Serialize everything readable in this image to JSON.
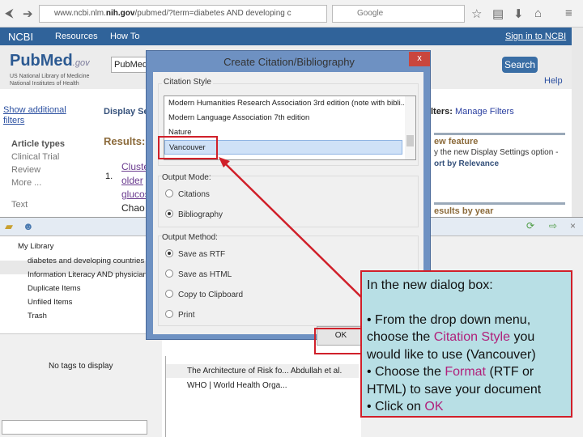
{
  "browser": {
    "url_prefix": "www.ncbi.nlm.",
    "url_domain": "nih.gov",
    "url_rest": "/pubmed/?term=diabetes AND developing c",
    "search_placeholder": "Google"
  },
  "ncbi": {
    "logo": "NCBI",
    "resources": "Resources",
    "howto": "How To",
    "signin": "Sign in to NCBI"
  },
  "pubmed": {
    "logo": "PubMed",
    "logo_suffix": ".gov",
    "nlm1": "US National Library of Medicine",
    "nlm2": "National Institutes of Health",
    "db": "PubMed",
    "search": "Search",
    "help": "Help"
  },
  "sidebar": {
    "show_filters": "Show additional filters",
    "article_types": "Article types",
    "items": [
      "Clinical Trial",
      "Review",
      "More ..."
    ],
    "text": "Text"
  },
  "results": {
    "display": "Display Se",
    "title": "Results:",
    "num": "1.",
    "link_lines": [
      "Cluste",
      "older",
      "glucos"
    ],
    "author": "Chao"
  },
  "right": {
    "filters_label": "lters:",
    "manage": "Manage Filters",
    "feature": "ew feature",
    "feature_text": "y the new Display Settings option -",
    "sort": "ort by Relevance",
    "by_year": "esults by year"
  },
  "zotero": {
    "tree": [
      "My Library",
      "diabetes and developing countries",
      "Information Literacy AND physician",
      "Duplicate Items",
      "Unfiled Items",
      "Trash"
    ],
    "tags_empty": "No tags to display",
    "items": [
      {
        "title": "The Architecture of Risk fo...",
        "creator": "Abdullah et al."
      },
      {
        "title": "WHO | World Health Orga...",
        "creator": ""
      }
    ]
  },
  "dialog": {
    "title": "Create Citation/Bibliography",
    "close": "x",
    "style_label": "Citation Style",
    "styles": [
      "Modern Humanities Research Association 3rd edition (note with bibli...",
      "Modern Language Association 7th edition",
      "Nature",
      "Vancouver"
    ],
    "selected_style": "Vancouver",
    "mode_label": "Output Mode:",
    "modes": [
      "Citations",
      "Bibliography"
    ],
    "selected_mode": "Bibliography",
    "method_label": "Output Method:",
    "methods": [
      "Save as RTF",
      "Save as HTML",
      "Copy to Clipboard",
      "Print"
    ],
    "selected_method": "Save as RTF",
    "ok": "OK"
  },
  "callout": {
    "intro": "In the new dialog box:",
    "b1a": "• From the drop down menu, choose the ",
    "b1h": "Citation Style",
    "b1b": " you would like to use (Vancouver)",
    "b2a": "• Choose the ",
    "b2h": "Format",
    "b2b": " (RTF or HTML) to save your document",
    "b3a": "• Click on ",
    "b3h": "OK"
  },
  "colors": {
    "annotation": "#d0202a",
    "callout_bg": "#b8dfe5",
    "ncbi_bar": "#30639a",
    "highlight": "#b0207a"
  }
}
